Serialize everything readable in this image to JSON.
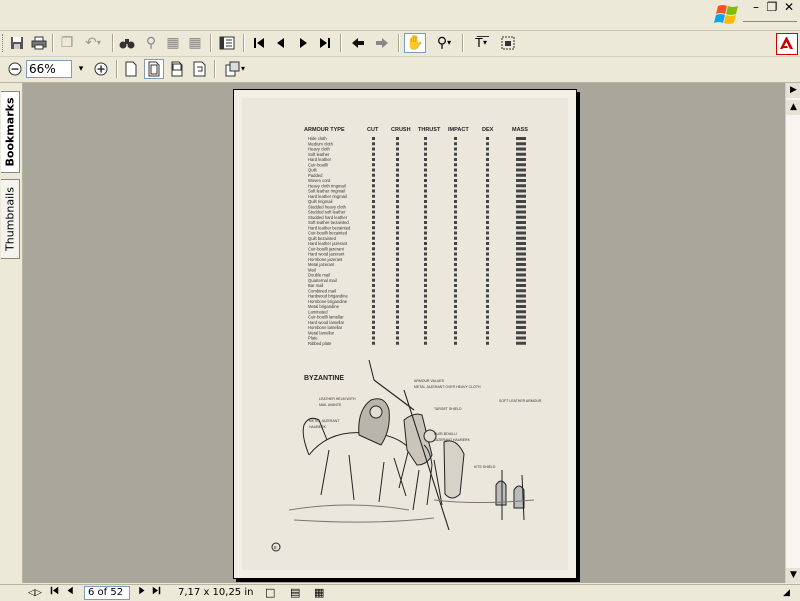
{
  "toolbar": {
    "zoom_value": "66%"
  },
  "side_tabs": {
    "bookmarks": "Bookmarks",
    "thumbnails": "Thumbnails"
  },
  "page_content": {
    "heading": "BYZANTINE",
    "table_headers": [
      "ARMOUR TYPE",
      "CUT",
      "CRUSH",
      "THRUST",
      "IMPACT",
      "DEX",
      "MASS"
    ],
    "armour_rows": [
      "Hide cloth",
      "Medium cloth",
      "Heavy cloth",
      "Soft leather",
      "Hard leather",
      "Cuir-bouilli",
      "Quilt",
      "Padded",
      "Woven cord",
      "Heavy cloth ringmail",
      "Soft leather ringmail",
      "Hard leather ringmail",
      "Quilt ringmail",
      "Studded heavy cloth",
      "Studded soft leather",
      "Studded hard leather",
      "Soft leather bezainted",
      "Hard leather bezainted",
      "Cuir-bouilli bezainted",
      "Quilt bezainted",
      "Hard leather jazerant",
      "Cuir-bouilli jazerant",
      "Hard wood jazerant",
      "Hornbone jazerant",
      "Metal jazerant",
      "Mail",
      "Double mail",
      "Quarternal mail",
      "Bar mail",
      "Combined mail",
      "Hardwood brigandine",
      "Hornbone brigandine",
      "Metal brigandine",
      "Laminated",
      "Cuir-bouilli lamellar",
      "Hard wood lamellar",
      "Hornbone lamellar",
      "Metal lamellar",
      "Plate",
      "Ribbed plate"
    ],
    "page_number": "8"
  },
  "status": {
    "page_field": "6 of 52",
    "page_size": "7,17 x 10,25 in"
  }
}
